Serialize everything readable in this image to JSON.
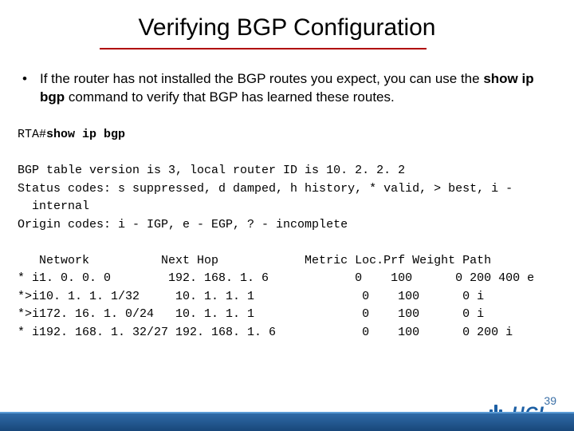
{
  "title": "Verifying BGP Configuration",
  "bullet": {
    "pre": "If the router has not installed the BGP routes you expect, you can use the ",
    "bold": "show ip bgp",
    "post": " command to verify that BGP has learned these routes."
  },
  "cli": {
    "prompt": "RTA#",
    "command": "show ip bgp",
    "version_line": "BGP table version is 3, local router ID is 10. 2. 2. 2",
    "status_line": "Status codes: s suppressed, d damped, h history, * valid, > best, i -\n  internal",
    "origin_line": "Origin codes: i - IGP, e - EGP, ? - incomplete",
    "table_header": "   Network          Next Hop            Metric Loc.Prf Weight Path",
    "rows": [
      "* i1. 0. 0. 0        192. 168. 1. 6            0    100      0 200 400 e",
      "*>i10. 1. 1. 1/32     10. 1. 1. 1               0    100      0 i",
      "*>i172. 16. 1. 0/24   10. 1. 1. 1               0    100      0 i",
      "* i192. 168. 1. 32/27 192. 168. 1. 6            0    100      0 200 i"
    ]
  },
  "page_number": "39",
  "logo_text": "HCL"
}
